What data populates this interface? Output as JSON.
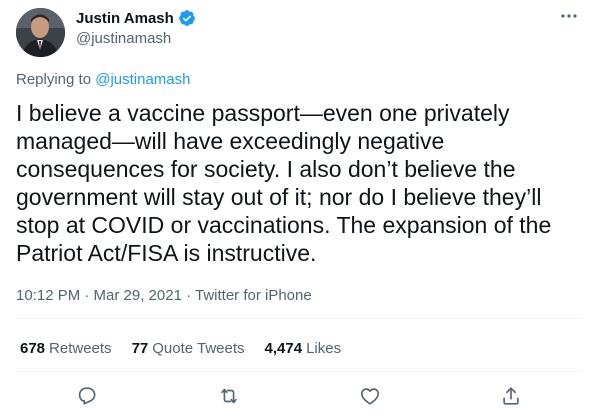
{
  "user": {
    "display_name": "Justin Amash",
    "handle": "@justinamash",
    "verified": true,
    "avatar_icon": "avatar-photo"
  },
  "reply": {
    "prefix": "Replying to ",
    "target": "@justinamash"
  },
  "tweet": {
    "text": "I believe a vaccine passport—even one privately managed—will have exceedingly negative consequences for society. I also don’t believe the government will stay out of it; nor do I believe they’ll stop at COVID or vaccinations. The expansion of the Patriot Act/FISA is instructive.",
    "meta": "10:12 PM · Mar 29, 2021 · Twitter for iPhone"
  },
  "stats": {
    "retweets_count": "678",
    "retweets_label": "Retweets",
    "quotes_count": "77",
    "quotes_label": "Quote Tweets",
    "likes_count": "4,474",
    "likes_label": "Likes"
  },
  "actions": {
    "reply_icon": "reply-icon",
    "retweet_icon": "retweet-icon",
    "like_icon": "heart-icon",
    "share_icon": "share-icon"
  },
  "colors": {
    "accent": "#1d9bf0",
    "text": "#0f1419",
    "secondary": "#536471",
    "divider": "#eff3f4"
  }
}
